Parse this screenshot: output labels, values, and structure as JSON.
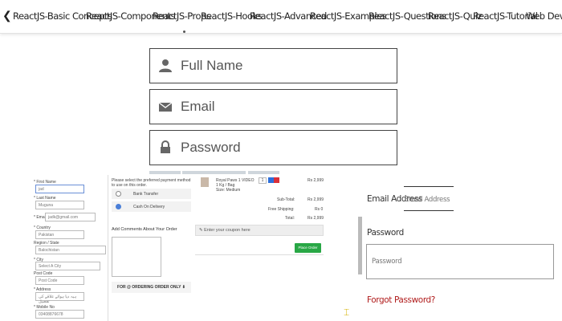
{
  "nav": {
    "chevron": "❮",
    "items": [
      "ReactJS-Basic Concepts",
      "ReactJS-Components",
      "ReactJS-Props",
      "ReactJS-Hooks",
      "ReactJS-Advanced",
      "ReactJS-Examples",
      "ReactJS-Questions",
      "ReactJS-Quiz",
      "ReactJS-Tutorial",
      "Web Dev"
    ]
  },
  "login": {
    "full_name": "Full Name",
    "email": "Email",
    "password": "Password",
    "icons": [
      "user-icon",
      "envelope-icon",
      "lock-icon"
    ]
  },
  "checkout_form": {
    "first_name_label": "* First Name",
    "first_name_value": "jad",
    "last_name_label": "* Last Name",
    "last_name_placeholder": "Muguna",
    "email_label": "* Email",
    "email_value": "jadk@gmail.com",
    "country_label": "* Country",
    "country_value": "Pakistan",
    "region_label": "Region / State",
    "region_value": "Balochistan",
    "city_label": "* City",
    "city_value": "Select A City",
    "post_code_label": "Post Code",
    "post_code_placeholder": "Post Code",
    "address_label": "* Address",
    "address_placeholder": "ہیہ دیا ہوائے علاقے کی تفصیل",
    "mobile_label": "* Mobile No",
    "mobile_value": "03408876678"
  },
  "payment": {
    "instruction": "Please select the preferred payment method to use on this order.",
    "bank_transfer": "Bank Transfer",
    "cash_on_delivery": "Cash On Delivery",
    "comments_label": "Add Comments About Your Order",
    "order_button": "FOR @ ORDERING ORDER ONLY ⬇"
  },
  "cart": {
    "item_name": "Royal Paws 1 VIDEO",
    "item_sub": "1 Kg / Bag",
    "item_extra": "Size: Medium",
    "qty": "1",
    "item_price": "Rs 2,999",
    "subtotal_label": "Sub-Total:",
    "subtotal_value": "Rs 2,999",
    "shipping_label": "Free Shipping:",
    "shipping_value": "Rs 0",
    "total_label": "Total:",
    "total_value": "Rs 2,999",
    "coupon_placeholder": "Enter your coupon here",
    "place_order": "Place Order"
  },
  "mini_login": {
    "email_label": "Email Address",
    "email_placeholder": "Email Address",
    "password_label": "Password",
    "password_placeholder": "Password",
    "forgot": "Forgot Password?"
  }
}
